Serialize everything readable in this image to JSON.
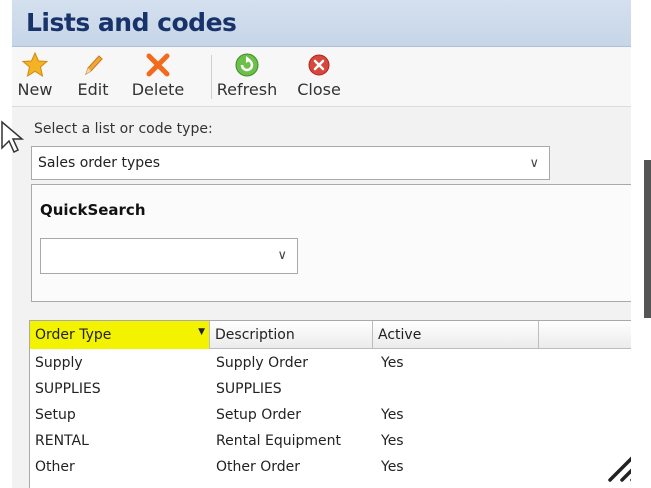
{
  "window": {
    "title": "Lists and codes"
  },
  "toolbar": {
    "buttons": [
      {
        "id": "new",
        "label": "New",
        "icon": "star-icon"
      },
      {
        "id": "edit",
        "label": "Edit",
        "icon": "pencil-icon"
      },
      {
        "id": "delete",
        "label": "Delete",
        "icon": "x-delete-icon"
      },
      {
        "id": "refresh",
        "label": "Refresh",
        "icon": "refresh-icon"
      },
      {
        "id": "close",
        "label": "Close",
        "icon": "close-circle-icon"
      }
    ]
  },
  "list_selector": {
    "label": "Select a list or code type:",
    "value": "Sales order types"
  },
  "quicksearch": {
    "title": "QuickSearch",
    "value": ""
  },
  "grid": {
    "columns": [
      "Order Type",
      "Description",
      "Active"
    ],
    "rows": [
      {
        "order_type": "Supply",
        "description": "Supply Order",
        "active": "Yes"
      },
      {
        "order_type": "SUPPLIES",
        "description": "SUPPLIES",
        "active": ""
      },
      {
        "order_type": "Setup",
        "description": "Setup Order",
        "active": "Yes"
      },
      {
        "order_type": "RENTAL",
        "description": "Rental Equipment",
        "active": "Yes"
      },
      {
        "order_type": "Other",
        "description": "Other Order",
        "active": "Yes"
      }
    ]
  },
  "colors": {
    "title_text": "#18326a",
    "title_bg": "#c6d5e8",
    "highlight": "#f3f300"
  }
}
